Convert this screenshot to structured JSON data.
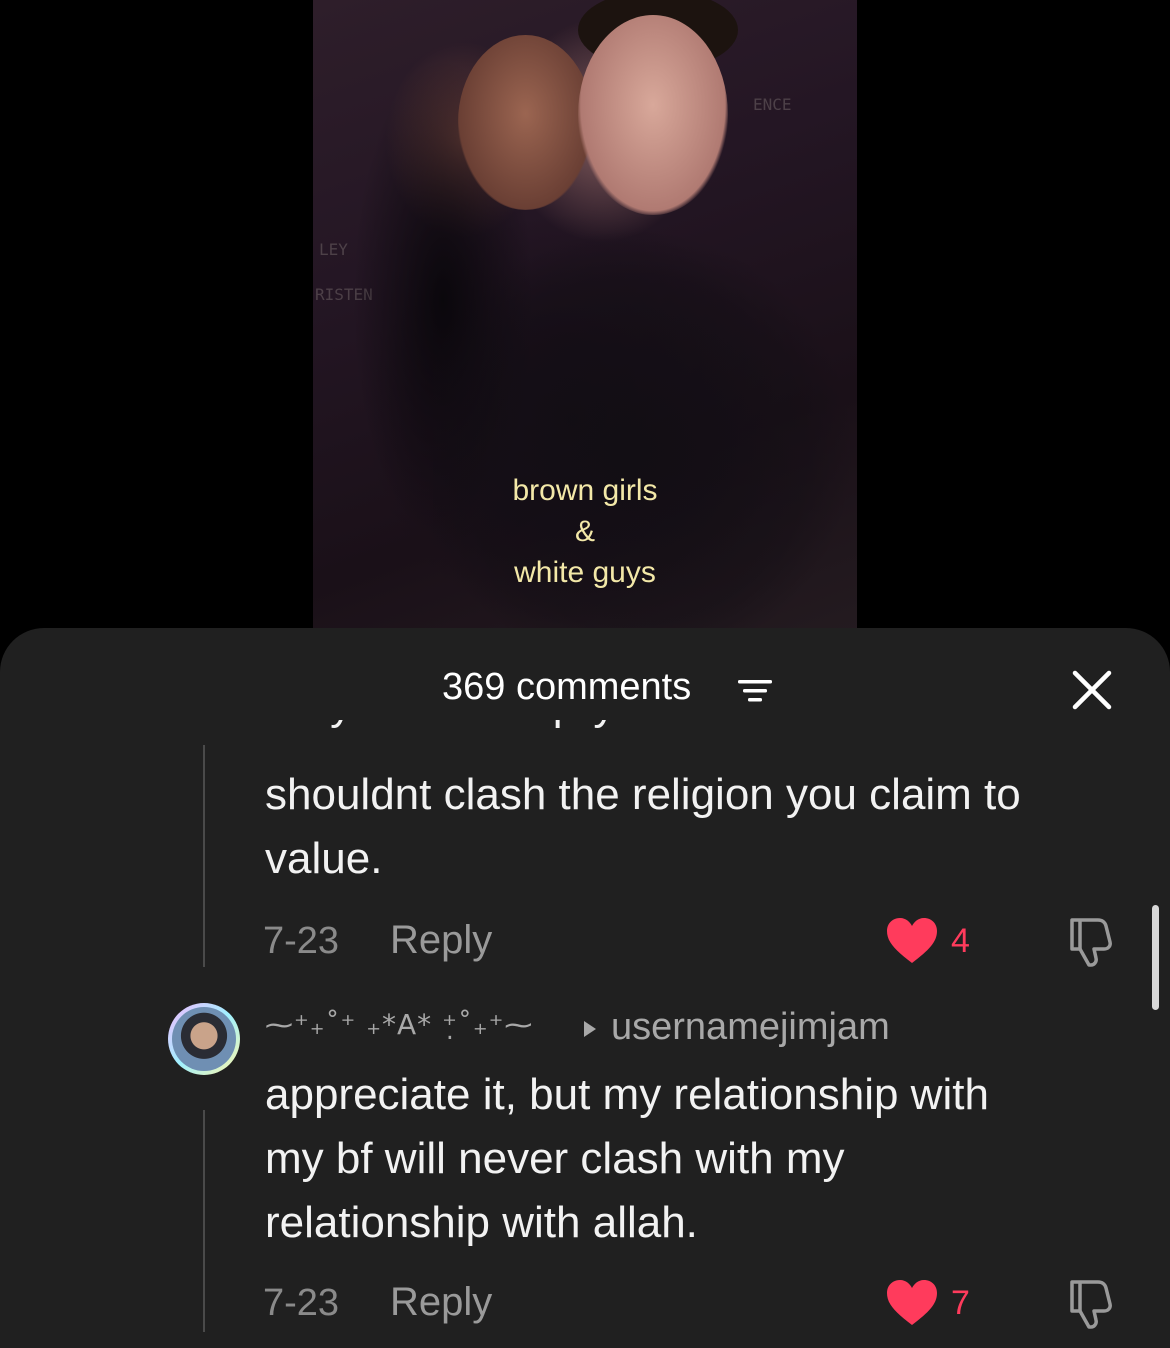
{
  "video": {
    "caption_lines": [
      "brown girls",
      "&",
      "white guys"
    ]
  },
  "comments_sheet": {
    "title": "369 comments",
    "comments": [
      {
        "text_lines": [
          "shouldnt clash the religion you claim to",
          "value."
        ],
        "date": "7-23",
        "reply_label": "Reply",
        "likes": "4",
        "liked": true
      },
      {
        "username": "⁓⁺₊˚⁺ ₊*A* ⁺̣˚₊⁺⁓",
        "reply_to": "usernamejimjam",
        "text_lines": [
          "appreciate it, but my relationship with",
          "my bf will never clash with my",
          "relationship with allah."
        ],
        "date": "7-23",
        "reply_label": "Reply",
        "likes": "7",
        "liked": true
      }
    ]
  },
  "colors": {
    "sheet_bg": "#202020",
    "like_red": "#ff3b5c",
    "caption_yellow": "#f3e8a8",
    "muted_text": "#8a8a8a"
  },
  "icons": {
    "sort": "sort-lines-icon",
    "close": "close-icon",
    "heart": "heart-icon",
    "dislike": "thumbs-down-icon",
    "reply_arrow": "triangle-right-icon"
  }
}
